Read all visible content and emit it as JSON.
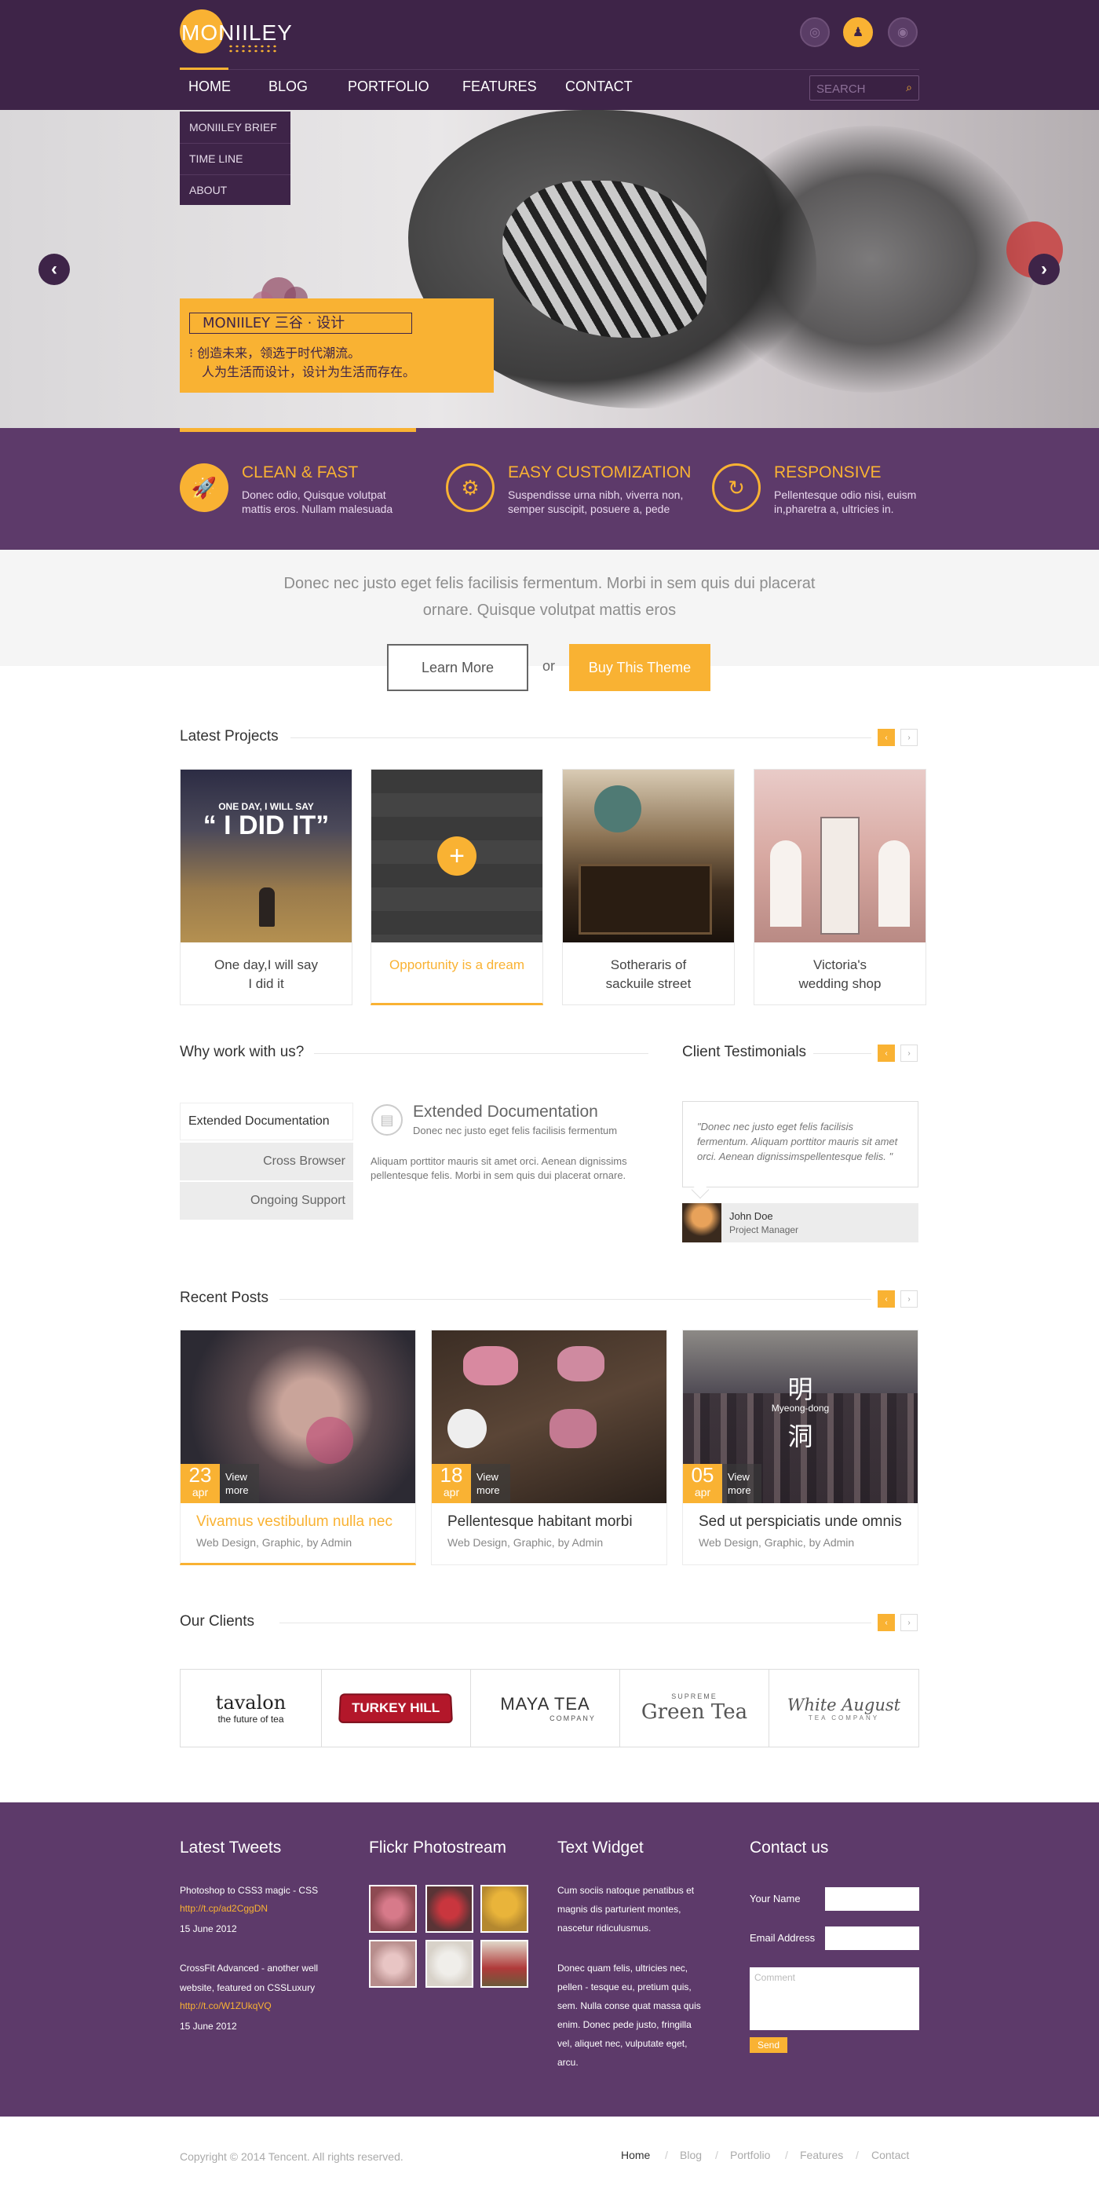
{
  "brand": {
    "name": "MONIILEY"
  },
  "header_icons": [
    {
      "icon": "wechat-icon",
      "glyph": "◎"
    },
    {
      "icon": "qq-icon",
      "glyph": "♟"
    },
    {
      "icon": "weibo-icon",
      "glyph": "◉"
    }
  ],
  "nav": {
    "items": [
      "HOME",
      "BLOG",
      "PORTFOLIO",
      "FEATURES",
      "CONTACT"
    ],
    "search_placeholder": "SEARCH",
    "dropdown": [
      "MONIILEY BRIEF",
      "TIME LINE",
      "ABOUT"
    ]
  },
  "hero": {
    "caption_title": "MONIILEY 三谷 · 设计",
    "caption_line1": "创造未来，领选于时代潮流。",
    "caption_line2": "人为生活而设计，设计为生活而存在。",
    "prev": "‹",
    "next": "›"
  },
  "features": [
    {
      "title": "CLEAN & FAST",
      "text1": "Donec odio, Quisque volutpat",
      "text2": "mattis eros. Nullam malesuada",
      "glyph": "🚀",
      "icon": "rocket-icon"
    },
    {
      "title": "EASY CUSTOMIZATION",
      "text1": "Suspendisse urna nibh, viverra non,",
      "text2": "semper suscipit, posuere a, pede",
      "glyph": "⚙",
      "icon": "gear-icon"
    },
    {
      "title": "RESPONSIVE",
      "text1": "Pellentesque odio nisi, euism",
      "text2": "in,pharetra a, ultricies in.",
      "glyph": "↻",
      "icon": "refresh-icon"
    }
  ],
  "intro": {
    "line1": "Donec nec justo eget felis facilisis fermentum. Morbi in sem quis dui placerat",
    "line2": "ornare. Quisque volutpat mattis eros",
    "learn_more": "Learn More",
    "or": "or",
    "buy": "Buy This Theme"
  },
  "projects": {
    "title": "Latest Projects",
    "prev": "‹",
    "next": "›",
    "items": [
      {
        "line1": "One day,I will say",
        "line2": "I did it",
        "overlay_small": "ONE DAY, I WILL SAY",
        "overlay_big": "“ I DID IT”"
      },
      {
        "line1": "Opportunity is a dream",
        "line2": "",
        "overlay_big": "+"
      },
      {
        "line1": "Sotheraris of",
        "line2": "sackuile street"
      },
      {
        "line1": "Victoria's",
        "line2": "wedding shop"
      }
    ]
  },
  "why": {
    "title": "Why work with us?",
    "tabs": [
      "Extended Documentation",
      "Cross Browser",
      "Ongoing Support"
    ],
    "panel_title": "Extended Documentation",
    "panel_sub": "Donec nec justo eget felis facilisis fermentum",
    "panel_text1": "Aliquam porttitor mauris sit amet orci. Aenean dignissims",
    "panel_text2": "pellentesque felis. Morbi in sem quis dui placerat ornare."
  },
  "testimonials": {
    "title": "Client Testimonials",
    "prev": "‹",
    "next": "›",
    "quote": "\"Donec nec justo eget felis facilisis fermentum. Aliquam porttitor mauris sit amet orci. Aenean dignissimspellentesque felis. \"",
    "name": "John Doe",
    "role": "Project Manager"
  },
  "posts": {
    "title": "Recent Posts",
    "prev": "‹",
    "next": "›",
    "view_more_1": "View",
    "view_more_2": "more",
    "items": [
      {
        "day": "23",
        "month": "apr",
        "title": "Vivamus vestibulum nulla nec",
        "meta": "Web Design, Graphic, by Admin"
      },
      {
        "day": "18",
        "month": "apr",
        "title": "Pellentesque habitant morbi",
        "meta": "Web Design, Graphic, by Admin"
      },
      {
        "day": "05",
        "month": "apr",
        "title": "Sed ut perspiciatis unde omnis",
        "meta": "Web Design, Graphic, by Admin",
        "overlay1": "明",
        "overlay2": "Myeong-dong",
        "overlay3": "洞"
      }
    ]
  },
  "clients": {
    "title": "Our Clients",
    "prev": "‹",
    "next": "›",
    "logos": [
      {
        "name": "tavalon",
        "sub": "the future of tea"
      },
      {
        "name": "TURKEY HILL",
        "sub": ""
      },
      {
        "name": "MAYA TEA",
        "sub": "COMPANY"
      },
      {
        "name": "Green Tea",
        "sub": "SUPREME"
      },
      {
        "name": "White August",
        "sub": "TEA COMPANY"
      }
    ]
  },
  "footer": {
    "tweets_title": "Latest Tweets",
    "tweets": [
      {
        "text": "Photoshop to CSS3 magic - CSS",
        "link": "http://t.cp/ad2CggDN",
        "date": "15 June 2012"
      },
      {
        "text1": "CrossFit Advanced - another well",
        "text2": "website, featured on CSSLuxury",
        "link": "http://t.co/W1ZUkqVQ",
        "date": "15 June 2012"
      }
    ],
    "flickr_title": "Flickr Photostream",
    "text_title": "Text Widget",
    "text_p1": [
      "Cum sociis natoque penatibus et",
      "magnis dis parturient montes,",
      "nascetur ridiculusmus."
    ],
    "text_p2": [
      "Donec quam felis, ultricies nec,",
      "pellen - tesque eu, pretium quis,",
      "sem. Nulla conse quat massa quis",
      "enim. Donec pede justo, fringilla",
      "vel, aliquet nec, vulputate eget,",
      "arcu."
    ],
    "contact_title": "Contact us",
    "your_name": "Your Name",
    "email": "Email Address",
    "comment_placeholder": "Comment",
    "send": "Send"
  },
  "bottom": {
    "copyright": "Copyright © 2014 Tencent. All rights reserved.",
    "links": [
      "Home",
      "Blog",
      "Portfolio",
      "Features",
      "Contact"
    ],
    "sep": "/"
  },
  "colors": {
    "purple_dark": "#3e2448",
    "purple": "#5d3a6a",
    "accent": "#f9b233"
  }
}
